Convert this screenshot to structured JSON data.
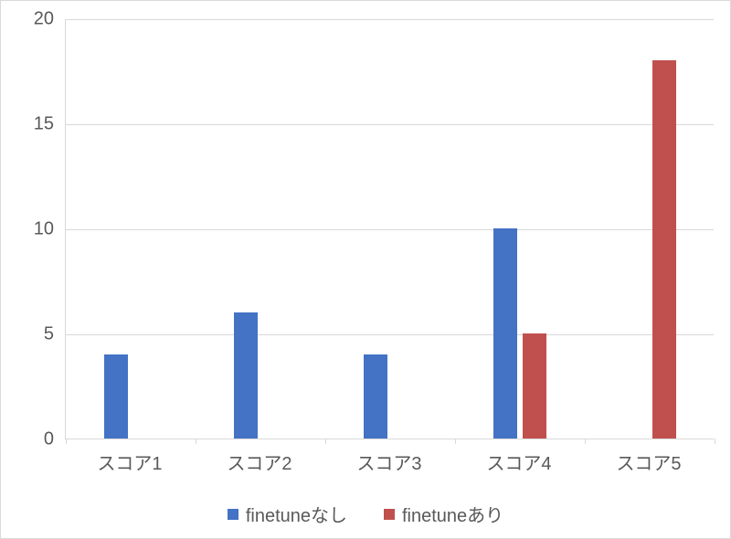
{
  "chart_data": {
    "type": "bar",
    "categories": [
      "スコア1",
      "スコア2",
      "スコア3",
      "スコア4",
      "スコア5"
    ],
    "series": [
      {
        "name": "finetuneなし",
        "values": [
          4,
          6,
          4,
          10,
          0
        ],
        "color": "#4472c4"
      },
      {
        "name": "finetuneあり",
        "values": [
          0,
          0,
          0,
          5,
          18
        ],
        "color": "#c0504d"
      }
    ],
    "ylim": [
      0,
      20
    ],
    "yticks": [
      0,
      5,
      10,
      15,
      20
    ],
    "title": "",
    "xlabel": "",
    "ylabel": ""
  }
}
